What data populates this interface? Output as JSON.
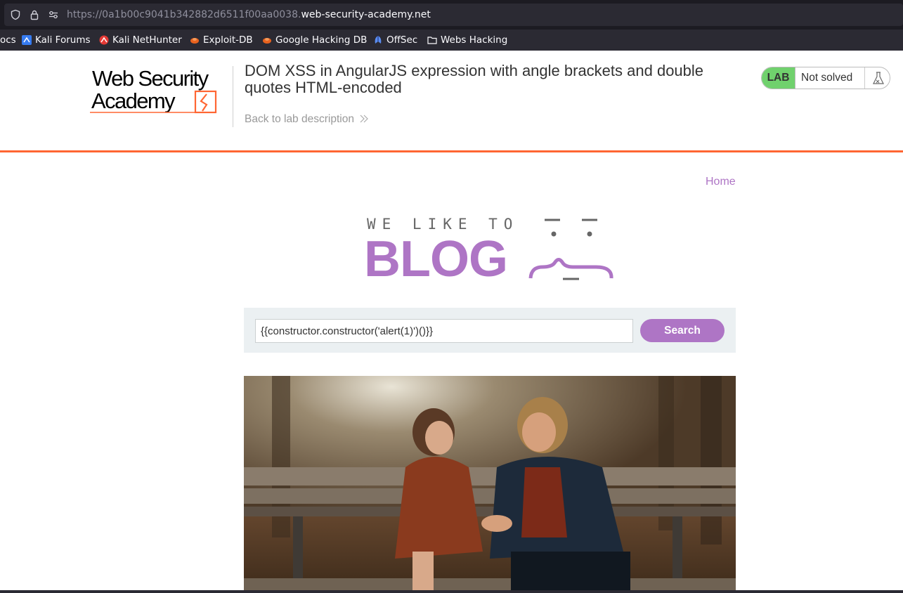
{
  "browser": {
    "url_prefix": "https://0a1b00c9041b342882d6511f00aa0038.",
    "url_host": "web-security-academy.net",
    "bookmarks": [
      {
        "label": "ocs",
        "icon": "docs-icon"
      },
      {
        "label": "Kali Forums",
        "icon": "kali-forums-icon"
      },
      {
        "label": "Kali NetHunter",
        "icon": "kali-nethunter-icon"
      },
      {
        "label": "Exploit-DB",
        "icon": "exploit-db-icon"
      },
      {
        "label": "Google Hacking DB",
        "icon": "google-hacking-db-icon"
      },
      {
        "label": "OffSec",
        "icon": "offsec-icon"
      },
      {
        "label": "Webs Hacking",
        "icon": "folder-icon"
      }
    ]
  },
  "lab_header": {
    "logo_line1": "Web Security",
    "logo_line2": "Academy",
    "title": "DOM XSS in AngularJS expression with angle brackets and double quotes HTML-encoded",
    "back_link": "Back to lab description",
    "lab_badge": "LAB",
    "status": "Not solved",
    "colors": {
      "accent": "#ff6633",
      "solved_green": "#70d16d"
    }
  },
  "blog": {
    "nav_home": "Home",
    "logo_top": "WE LIKE TO",
    "logo_main": "BLOG",
    "search_value": "{{constructor.constructor('alert(1)')()}}",
    "search_button": "Search",
    "accent": "#ae75c5"
  }
}
